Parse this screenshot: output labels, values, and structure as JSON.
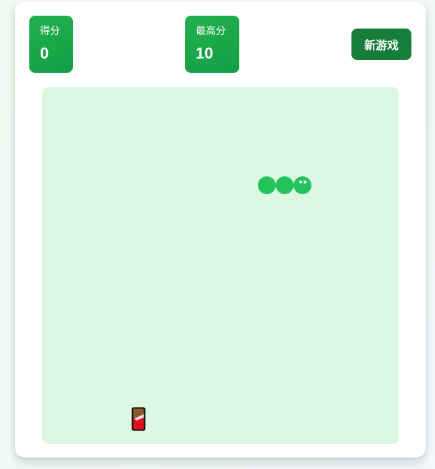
{
  "scoreboard": {
    "score_label": "得分",
    "score_value": "0",
    "best_label": "最高分",
    "best_value": "10"
  },
  "controls": {
    "new_game_label": "新游戏"
  },
  "colors": {
    "accent": "#1aa84a",
    "button": "#167d3a",
    "board_bg": "#dcf8e3",
    "snake": "#22c35a",
    "food_body": "#e0101f",
    "food_top": "#8b5a2b"
  },
  "snake": {
    "direction": "right",
    "length": 3
  },
  "food": {
    "icon": "chocolate-bar-icon"
  }
}
